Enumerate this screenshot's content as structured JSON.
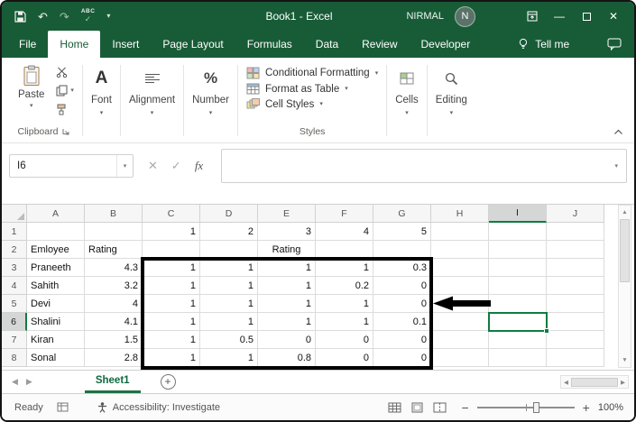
{
  "titlebar": {
    "title": "Book1 - Excel",
    "user_name": "NIRMAL",
    "avatar_initial": "N",
    "spelling_abc": "ABC"
  },
  "tabs": {
    "items": [
      {
        "label": "File",
        "active": false
      },
      {
        "label": "Home",
        "active": true
      },
      {
        "label": "Insert",
        "active": false
      },
      {
        "label": "Page Layout",
        "active": false
      },
      {
        "label": "Formulas",
        "active": false
      },
      {
        "label": "Data",
        "active": false
      },
      {
        "label": "Review",
        "active": false
      },
      {
        "label": "Developer",
        "active": false
      }
    ],
    "tell_me": "Tell me"
  },
  "ribbon": {
    "paste_label": "Paste",
    "groups": {
      "clipboard": "Clipboard",
      "font": "Font",
      "alignment": "Alignment",
      "number": "Number",
      "styles": "Styles",
      "cells": "Cells",
      "editing": "Editing"
    },
    "styles_buttons": [
      "Conditional Formatting",
      "Format as Table",
      "Cell Styles"
    ]
  },
  "formula_bar": {
    "name_box": "I6",
    "fx_label": "fx",
    "formula_value": ""
  },
  "sheet": {
    "columns": [
      "A",
      "B",
      "C",
      "D",
      "E",
      "F",
      "G",
      "H",
      "I",
      "J"
    ],
    "row_numbers": [
      "1",
      "2",
      "3",
      "4",
      "5",
      "6",
      "7",
      "8"
    ],
    "active_cell": "I6",
    "active_column": "I",
    "active_row": "6",
    "rows": [
      {
        "C": "1",
        "D": "2",
        "E": "3",
        "F": "4",
        "G": "5"
      },
      {
        "A": "Emloyee",
        "B": "Rating",
        "E": "Rating"
      },
      {
        "A": "Praneeth",
        "B": "4.3",
        "C": "1",
        "D": "1",
        "E": "1",
        "F": "1",
        "G": "0.3"
      },
      {
        "A": "Sahith",
        "B": "3.2",
        "C": "1",
        "D": "1",
        "E": "1",
        "F": "0.2",
        "G": "0"
      },
      {
        "A": "Devi",
        "B": "4",
        "C": "1",
        "D": "1",
        "E": "1",
        "F": "1",
        "G": "0"
      },
      {
        "A": "Shalini",
        "B": "4.1",
        "C": "1",
        "D": "1",
        "E": "1",
        "F": "1",
        "G": "0.1"
      },
      {
        "A": "Kiran",
        "B": "1.5",
        "C": "1",
        "D": "0.5",
        "E": "0",
        "F": "0",
        "G": "0"
      },
      {
        "A": "Sonal",
        "B": "2.8",
        "C": "1",
        "D": "1",
        "E": "0.8",
        "F": "0",
        "G": "0"
      }
    ]
  },
  "annotations": {
    "selection_box_range": "C3:G8",
    "arrow_direction": "left",
    "color": "#000000"
  },
  "sheet_tabs": {
    "active": "Sheet1"
  },
  "status_bar": {
    "mode": "Ready",
    "accessibility": "Accessibility: Investigate",
    "zoom": "100%"
  },
  "colors": {
    "excel_green_dark": "#185C37",
    "excel_green": "#107C41",
    "header_active_bg": "#D5D7D6"
  }
}
